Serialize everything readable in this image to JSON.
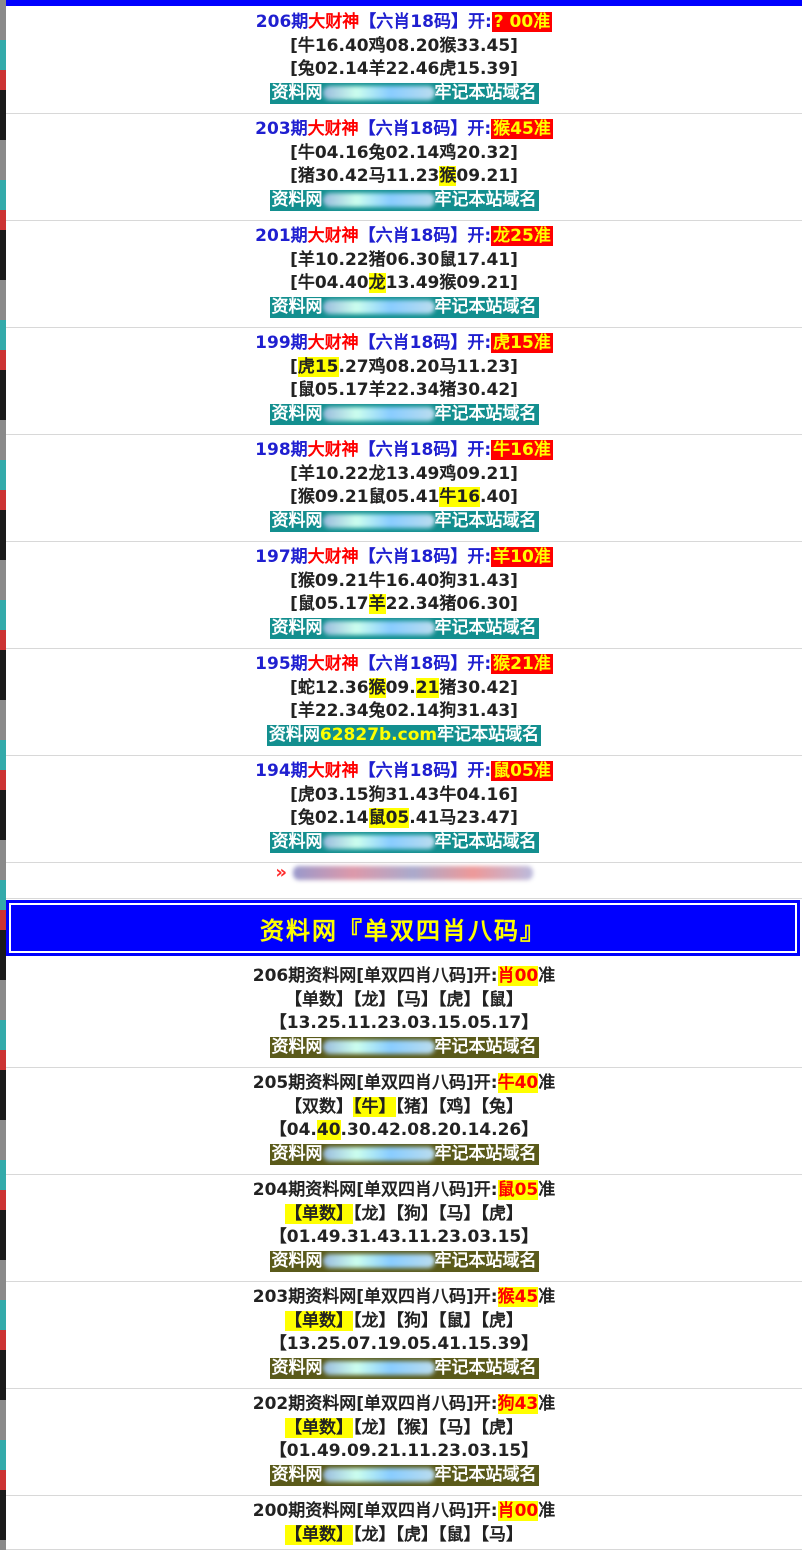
{
  "deco": {
    "left_strip_colors": [
      "#8a8a8a",
      "#33aaaa",
      "#cc3333",
      "#1a1a1a"
    ],
    "top_border_color": "#0000ff"
  },
  "site_bar": {
    "prefix": "资料网",
    "visible_domain": "62827b.com",
    "suffix": "牢记本站域名"
  },
  "section1": {
    "rows": [
      {
        "period": "206期",
        "name": "大财神",
        "type": "【六肖18码】",
        "kai": "开:",
        "result": "? 00准",
        "l2": "[牛16.40鸡08.20猴33.45]",
        "l3": "[兔02.14羊22.46虎15.39]",
        "site_clear": false
      },
      {
        "period": "203期",
        "name": "大财神",
        "type": "【六肖18码】",
        "kai": "开:",
        "result": "猴45准",
        "l2": "[牛04.16兔02.14鸡20.32]",
        "l3_a": "[猪30.42马11.23",
        "l3_hl": "猴",
        "l3_b": "09.21]",
        "site_clear": false
      },
      {
        "period": "201期",
        "name": "大财神",
        "type": "【六肖18码】",
        "kai": "开:",
        "result": "龙25准",
        "l2": "[羊10.22猪06.30鼠17.41]",
        "l3_a": "[牛04.40",
        "l3_hl": "龙",
        "l3_b": "13.49猴09.21]",
        "site_clear": false
      },
      {
        "period": "199期",
        "name": "大财神",
        "type": "【六肖18码】",
        "kai": "开:",
        "result": "虎15准",
        "l2_a": "[",
        "l2_hl": "虎15",
        "l2_b": ".27鸡08.20马11.23]",
        "l3": "[鼠05.17羊22.34猪30.42]",
        "site_clear": false
      },
      {
        "period": "198期",
        "name": "大财神",
        "type": "【六肖18码】",
        "kai": "开:",
        "result": "牛16准",
        "l2": "[羊10.22龙13.49鸡09.21]",
        "l3_a": "[猴09.21鼠05.41",
        "l3_hl": "牛16",
        "l3_b": ".40]",
        "site_clear": false
      },
      {
        "period": "197期",
        "name": "大财神",
        "type": "【六肖18码】",
        "kai": "开:",
        "result": "羊10准",
        "l2": "[猴09.21牛16.40狗31.43]",
        "l3_a": "[鼠05.17",
        "l3_hl": "羊",
        "l3_b": "22.34猪06.30]",
        "site_clear": false
      },
      {
        "period": "195期",
        "name": "大财神",
        "type": "【六肖18码】",
        "kai": "开:",
        "result": "猴21准",
        "l2_a": "[蛇12.36",
        "l2_hl": "猴",
        "l2_m": "09.",
        "l2_hl2": "21",
        "l2_b": "猪30.42]",
        "l3": "[羊22.34兔02.14狗31.43]",
        "site_clear": true
      },
      {
        "period": "194期",
        "name": "大财神",
        "type": "【六肖18码】",
        "kai": "开:",
        "result": "鼠05准",
        "l2": "[虎03.15狗31.43牛04.16]",
        "l3_a": "[兔02.14",
        "l3_hl": "鼠05",
        "l3_b": ".41马23.47]",
        "site_clear": false
      }
    ]
  },
  "ad": {
    "arrow": "»"
  },
  "section2": {
    "header": "资料网『单双四肖八码』",
    "rows": [
      {
        "title": "206期资料网[单双四肖八码]开:",
        "result": "肖00",
        "zhun": "准",
        "cells": [
          "【单数】",
          "【龙】",
          "【马】",
          "【虎】",
          "【鼠】"
        ],
        "hl_index": -1,
        "nums_a": "【13.25.11.23.03.15.05.17】",
        "nums_hl": "",
        "nums_b": ""
      },
      {
        "title": "205期资料网[单双四肖八码]开:",
        "result": "牛40",
        "zhun": "准",
        "cells": [
          "【双数】",
          "【牛】",
          "【猪】",
          "【鸡】",
          "【兔】"
        ],
        "hl_index": 1,
        "nums_a": "【04.",
        "nums_hl": "40",
        "nums_b": ".30.42.08.20.14.26】"
      },
      {
        "title": "204期资料网[单双四肖八码]开:",
        "result": "鼠05",
        "zhun": "准",
        "cells": [
          "【单数】",
          "【龙】",
          "【狗】",
          "【马】",
          "【虎】"
        ],
        "hl_index": 0,
        "nums_a": "【01.49.31.43.11.23.03.15】",
        "nums_hl": "",
        "nums_b": ""
      },
      {
        "title": "203期资料网[单双四肖八码]开:",
        "result": "猴45",
        "zhun": "准",
        "cells": [
          "【单数】",
          "【龙】",
          "【狗】",
          "【鼠】",
          "【虎】"
        ],
        "hl_index": 0,
        "nums_a": "【13.25.07.19.05.41.15.39】",
        "nums_hl": "",
        "nums_b": ""
      },
      {
        "title": "202期资料网[单双四肖八码]开:",
        "result": "狗43",
        "zhun": "准",
        "cells": [
          "【单数】",
          "【龙】",
          "【猴】",
          "【马】",
          "【虎】"
        ],
        "hl_index": 0,
        "nums_a": "【01.49.09.21.11.23.03.15】",
        "nums_hl": "",
        "nums_b": ""
      },
      {
        "title": "200期资料网[单双四肖八码]开:",
        "result": "肖00",
        "zhun": "准",
        "cells": [
          "【单数】",
          "【龙】",
          "【虎】",
          "【鼠】",
          "【马】"
        ],
        "hl_index": 0,
        "nums_a": "",
        "nums_hl": "",
        "nums_b": ""
      }
    ]
  }
}
